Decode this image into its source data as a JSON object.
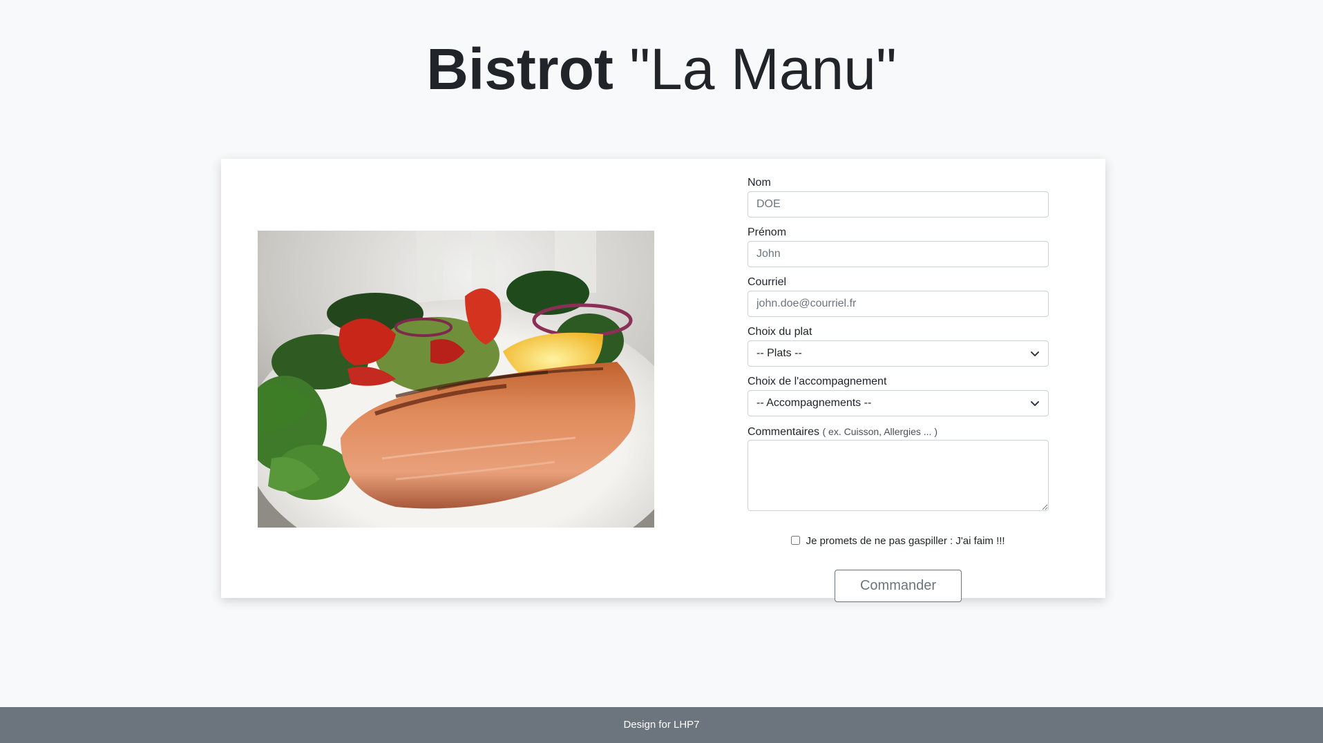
{
  "header": {
    "title_bold": "Bistrot",
    "title_light": "\"La Manu\""
  },
  "photo": {
    "alt": "Grilled salmon fillet with salad",
    "description_icon": "salmon-dish-image"
  },
  "form": {
    "nom": {
      "label": "Nom",
      "placeholder": "DOE"
    },
    "prenom": {
      "label": "Prénom",
      "placeholder": "John"
    },
    "courriel": {
      "label": "Courriel",
      "placeholder": "john.doe@courriel.fr"
    },
    "plat": {
      "label": "Choix du plat",
      "selected": "-- Plats --"
    },
    "accompagnement": {
      "label": "Choix de l'accompagnement",
      "selected": "-- Accompagnements --"
    },
    "commentaires": {
      "label": "Commentaires",
      "hint": "( ex. Cuisson, Allergies ... )"
    },
    "checkbox_label": "Je promets de ne pas gaspiller : J'ai faim !!!",
    "submit_label": "Commander"
  },
  "footer": {
    "text": "Design for LHP7"
  },
  "colors": {
    "background": "#f8f9fa",
    "card": "#ffffff",
    "footer": "#6c757d",
    "text": "#212529",
    "border": "#ced4da",
    "muted": "#6c757d"
  }
}
